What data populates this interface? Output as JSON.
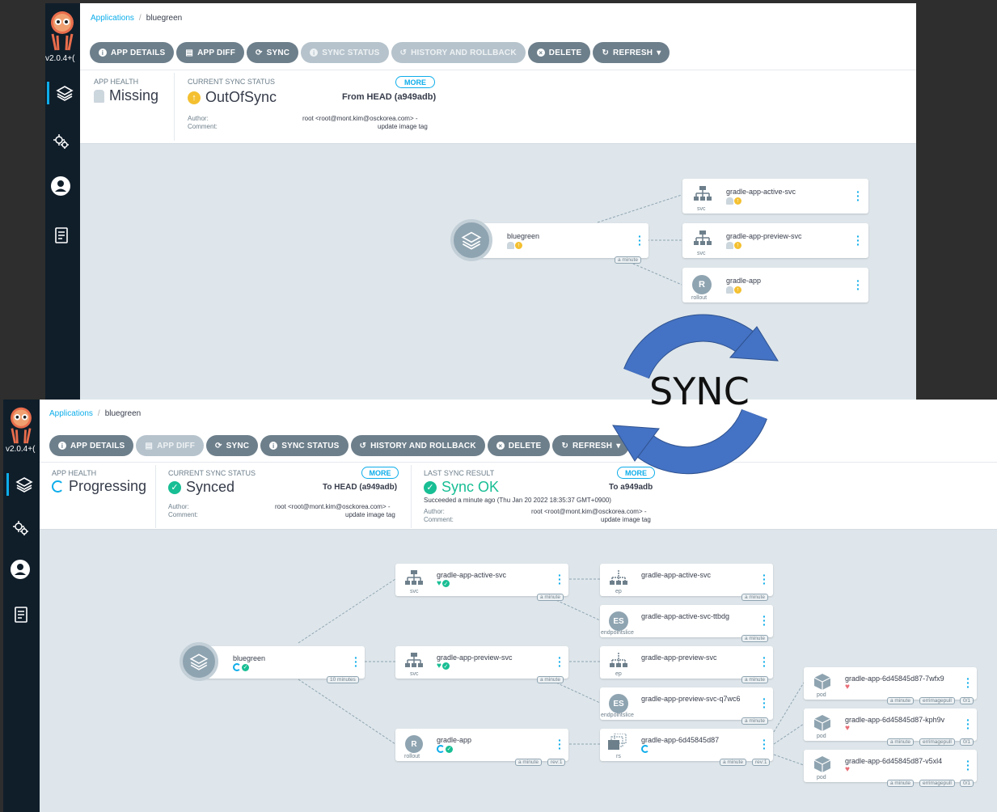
{
  "top": {
    "version": "v2.0.4+(",
    "breadcrumb": {
      "root": "Applications",
      "current": "bluegreen"
    },
    "toolbar": [
      "APP DETAILS",
      "APP DIFF",
      "SYNC",
      "SYNC STATUS",
      "HISTORY AND ROLLBACK",
      "DELETE",
      "REFRESH"
    ],
    "app_health": {
      "label": "APP HEALTH",
      "value": "Missing"
    },
    "sync_status": {
      "label": "CURRENT SYNC STATUS",
      "value": "OutOfSync",
      "more": "MORE",
      "from": "From HEAD (a949adb)",
      "author_label": "Author:",
      "author": "root <root@mont.kim@osckorea.com> -",
      "comment_label": "Comment:",
      "comment": "update image tag"
    },
    "tree": {
      "root": {
        "name": "bluegreen",
        "age": "a minute"
      },
      "children": [
        {
          "name": "gradle-app-active-svc",
          "kind": "svc"
        },
        {
          "name": "gradle-app-preview-svc",
          "kind": "svc"
        },
        {
          "name": "gradle-app",
          "kind": "rollout",
          "letter": "R"
        }
      ]
    }
  },
  "overlay": {
    "text": "SYNC",
    "color": "#4472c4"
  },
  "bottom": {
    "version": "v2.0.4+(",
    "breadcrumb": {
      "root": "Applications",
      "current": "bluegreen"
    },
    "toolbar": [
      "APP DETAILS",
      "APP DIFF",
      "SYNC",
      "SYNC STATUS",
      "HISTORY AND ROLLBACK",
      "DELETE",
      "REFRESH"
    ],
    "app_health": {
      "label": "APP HEALTH",
      "value": "Progressing"
    },
    "sync_status": {
      "label": "CURRENT SYNC STATUS",
      "value": "Synced",
      "more": "MORE",
      "to": "To HEAD (a949adb)",
      "author_label": "Author:",
      "author": "root <root@mont.kim@osckorea.com> -",
      "comment_label": "Comment:",
      "comment": "update image tag"
    },
    "last_sync": {
      "label": "LAST SYNC RESULT",
      "value": "Sync OK",
      "more": "MORE",
      "to": "To a949adb",
      "succeeded": "Succeeded a minute ago (Thu Jan 20 2022 18:35:37 GMT+0900)",
      "author_label": "Author:",
      "author": "root <root@mont.kim@osckorea.com> -",
      "comment_label": "Comment:",
      "comment": "update image tag"
    },
    "tree": {
      "root": {
        "name": "bluegreen",
        "age": "10 minutes"
      },
      "col1": [
        {
          "name": "gradle-app-active-svc",
          "kind": "svc",
          "age": "a minute"
        },
        {
          "name": "gradle-app-preview-svc",
          "kind": "svc",
          "age": "a minute"
        },
        {
          "name": "gradle-app",
          "kind": "rollout",
          "letter": "R",
          "age": "a minute",
          "rev": "rev:1"
        }
      ],
      "col2": [
        {
          "name": "gradle-app-active-svc",
          "kind": "ep",
          "age": "a minute"
        },
        {
          "name": "gradle-app-active-svc-ttbdg",
          "kind": "endpointslice",
          "letter": "ES",
          "age": "a minute"
        },
        {
          "name": "gradle-app-preview-svc",
          "kind": "ep",
          "age": "a minute"
        },
        {
          "name": "gradle-app-preview-svc-q7wc6",
          "kind": "endpointslice",
          "letter": "ES",
          "age": "a minute"
        },
        {
          "name": "gradle-app-6d45845d87",
          "kind": "rs",
          "age": "a minute",
          "rev": "rev:1"
        }
      ],
      "pods": [
        {
          "name": "gradle-app-6d45845d87-7wfx9",
          "kind": "pod",
          "age": "a minute",
          "reason": "errimagepull",
          "ready": "0/1"
        },
        {
          "name": "gradle-app-6d45845d87-kph9v",
          "kind": "pod",
          "age": "a minute",
          "reason": "errimagepull",
          "ready": "0/1"
        },
        {
          "name": "gradle-app-6d45845d87-v5xl4",
          "kind": "pod",
          "age": "a minute",
          "reason": "errimagepull",
          "ready": "0/1"
        }
      ]
    }
  }
}
